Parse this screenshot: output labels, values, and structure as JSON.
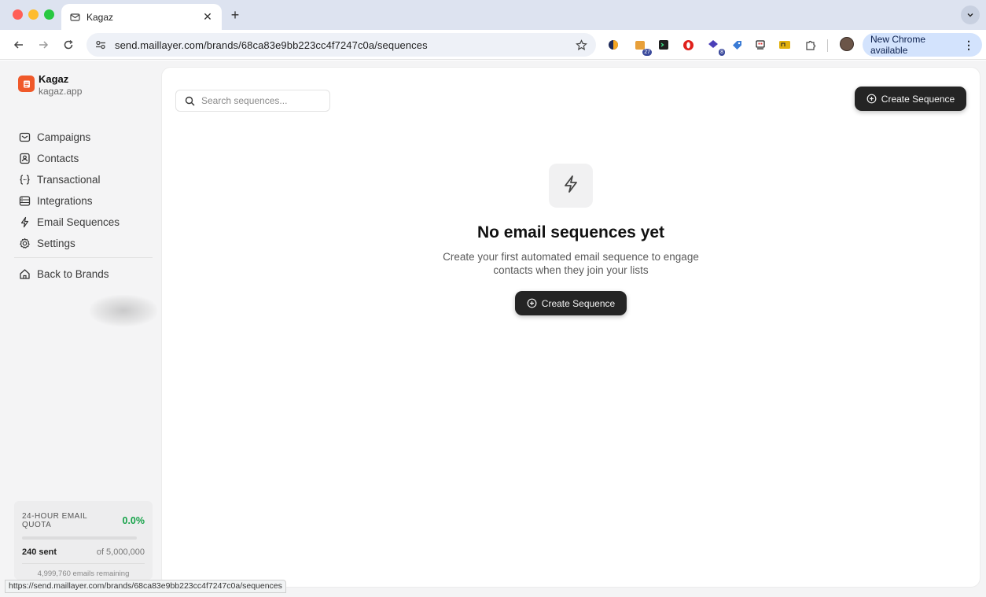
{
  "browser": {
    "tab_title": "Kagaz",
    "url": "send.maillayer.com/brands/68ca83e9bb223cc4f7247c0a/sequences",
    "update_label": "New Chrome available",
    "extension_badges": {
      "ext2": "27",
      "ext5": "8"
    },
    "status_url": "https://send.maillayer.com/brands/68ca83e9bb223cc4f7247c0a/sequences"
  },
  "brand": {
    "name": "Kagaz",
    "domain": "kagaz.app",
    "logo_color": "#f0592a"
  },
  "sidebar": {
    "items": [
      {
        "label": "Campaigns",
        "icon": "mail-icon"
      },
      {
        "label": "Contacts",
        "icon": "contacts-icon"
      },
      {
        "label": "Transactional",
        "icon": "braces-icon"
      },
      {
        "label": "Integrations",
        "icon": "integrations-icon"
      },
      {
        "label": "Email Sequences",
        "icon": "lightning-icon"
      },
      {
        "label": "Settings",
        "icon": "gear-icon"
      }
    ],
    "back_label": "Back to Brands"
  },
  "quota": {
    "title": "24-HOUR EMAIL QUOTA",
    "percent": "0.0%",
    "percent_value": 0.0,
    "sent": "240 sent",
    "of_total": "of 5,000,000",
    "remaining": "4,999,760 emails remaining",
    "accent_color": "#17a34a"
  },
  "main": {
    "search_placeholder": "Search sequences...",
    "create_button_label": "Create Sequence",
    "empty_title": "No email sequences yet",
    "empty_description": "Create your first automated email sequence to engage contacts when they join your lists",
    "empty_button_label": "Create Sequence"
  }
}
